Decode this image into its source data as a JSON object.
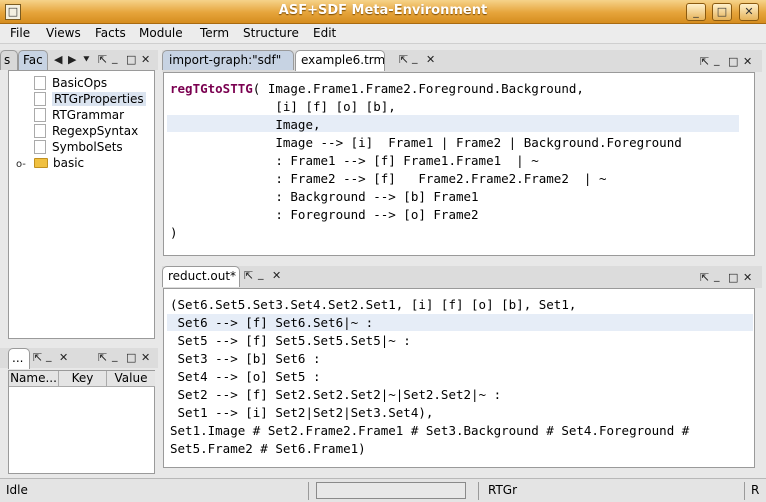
{
  "window": {
    "title": "ASF+SDF Meta-Environment",
    "app_icon": "□",
    "minimize_glyph": "_",
    "maximize_glyph": "□",
    "close_glyph": "✕"
  },
  "menu": [
    "File",
    "Views",
    "Facts",
    "Module",
    "Term",
    "Structure",
    "Edit"
  ],
  "left_panel": {
    "tabs": [
      "s",
      "Fac"
    ],
    "tree": [
      "BasicOps",
      "RTGrProperties",
      "RTGrammar",
      "RegexpSyntax",
      "SymbolSets"
    ],
    "folder_item": "basic",
    "expander": "o-"
  },
  "lower_left": {
    "tab1": "...",
    "columns": [
      "Name...",
      "Key",
      "Value"
    ]
  },
  "controls": {
    "left": "◀",
    "right": "▶",
    "down": "⯆",
    "pin": "⇱",
    "min": "_",
    "max": "□",
    "close": "✕"
  },
  "editor": {
    "tabs": [
      "import-graph:\"sdf\"",
      "example6.trm*"
    ],
    "keyword": "regTGtoSTTG",
    "first_line_rest": "( Image.Frame1.Frame2.Foreground.Background,",
    "lines": [
      "              [i] [f] [o] [b],",
      "              Image,",
      "              Image --> [i]  Frame1 | Frame2 | Background.Foreground",
      "              : Frame1 --> [f] Frame1.Frame1  | ~",
      "              : Frame2 --> [f]   Frame2.Frame2.Frame2  | ~",
      "              : Background --> [b] Frame1",
      "              : Foreground --> [o] Frame2",
      ")"
    ]
  },
  "reduct": {
    "tab": "reduct.out*",
    "lines": [
      "(Set6.Set5.Set3.Set4.Set2.Set1, [i] [f] [o] [b], Set1,",
      " Set6 --> [f] Set6.Set6|~ :",
      " Set5 --> [f] Set5.Set5.Set5|~ :",
      " Set3 --> [b] Set6 :",
      " Set4 --> [o] Set5 :",
      " Set2 --> [f] Set2.Set2.Set2|~|Set2.Set2|~ :",
      " Set1 --> [i] Set2|Set2|Set3.Set4),",
      "Set1.Image # Set2.Frame2.Frame1 # Set3.Background # Set4.Foreground #",
      "Set5.Frame2 # Set6.Frame1)"
    ]
  },
  "status": {
    "left": "Idle",
    "module": "RTGr",
    "right": "R"
  }
}
